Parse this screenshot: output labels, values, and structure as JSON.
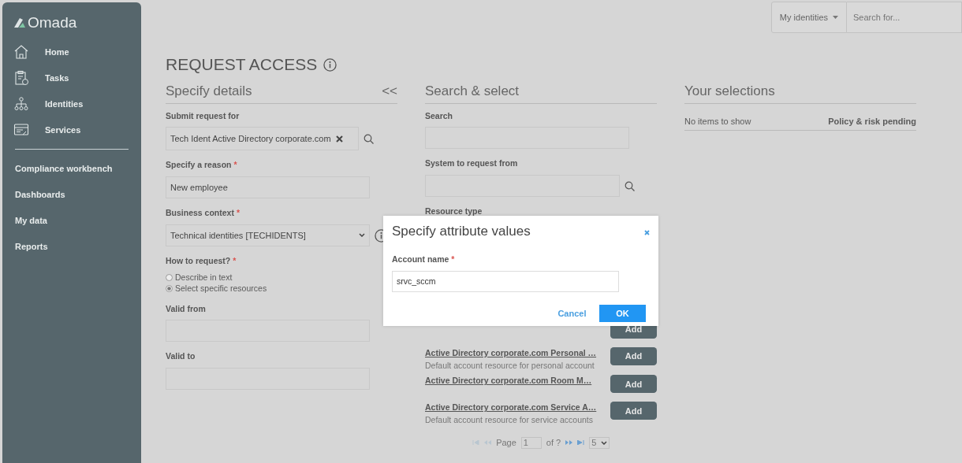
{
  "sidebar": {
    "logo": "Omada",
    "items": [
      {
        "label": "Home"
      },
      {
        "label": "Tasks"
      },
      {
        "label": "Identities"
      },
      {
        "label": "Services"
      }
    ],
    "links": [
      "Compliance workbench",
      "Dashboards",
      "My data",
      "Reports"
    ]
  },
  "topbar": {
    "scope": "My identities",
    "search": {
      "placeholder": "Search for..."
    }
  },
  "page_title": "REQUEST ACCESS",
  "details": {
    "title": "Specify details",
    "collapse": "<<",
    "fields": [
      {
        "kind": "chip",
        "label": "Submit request for",
        "value": "Tech Ident Active Directory corporate.com"
      },
      {
        "kind": "text",
        "label": "Specify a reason",
        "required_mark": "*",
        "value": "New employee"
      },
      {
        "kind": "select",
        "label": "Business context",
        "required_mark": "*",
        "value": "Technical identities [TECHIDENTS]"
      },
      {
        "kind": "radio",
        "label": "How to request?",
        "required_mark": "*",
        "options": [
          {
            "label": "Describe in text",
            "selected": false
          },
          {
            "label": "Select specific resources",
            "selected": true
          }
        ]
      },
      {
        "kind": "text",
        "label": "Valid from"
      },
      {
        "kind": "text",
        "label": "Valid to"
      }
    ]
  },
  "search_select": {
    "title": "Search & select",
    "fields": [
      {
        "kind": "text",
        "label": "Search"
      },
      {
        "kind": "lookup",
        "label": "System to request from"
      },
      {
        "kind": "hidden",
        "label": "Resource type"
      }
    ],
    "resources": [
      {
        "button": "Add"
      },
      {
        "name": "Active Directory corporate.com Personal …",
        "description": "Default account resource for personal account",
        "button": "Add"
      },
      {
        "name": "Active Directory corporate.com Room M…",
        "button": "Add"
      },
      {
        "name": "Active Directory corporate.com Service A…",
        "description": "Default account resource for service accounts",
        "button": "Add"
      }
    ],
    "pager": {
      "page_label": "Page",
      "page": "1",
      "of": "of ?",
      "page_size": "5"
    }
  },
  "selections": {
    "title": "Your selections",
    "empty": "No items to show",
    "status": "Policy & risk pending"
  },
  "dialog": {
    "title": "Specify attribute values",
    "field": {
      "label": "Account name",
      "required_mark": "*",
      "value": "srvc_sccm"
    },
    "buttons": [
      {
        "label": "Cancel",
        "kind": "link"
      },
      {
        "label": "OK",
        "kind": "primary"
      }
    ]
  }
}
